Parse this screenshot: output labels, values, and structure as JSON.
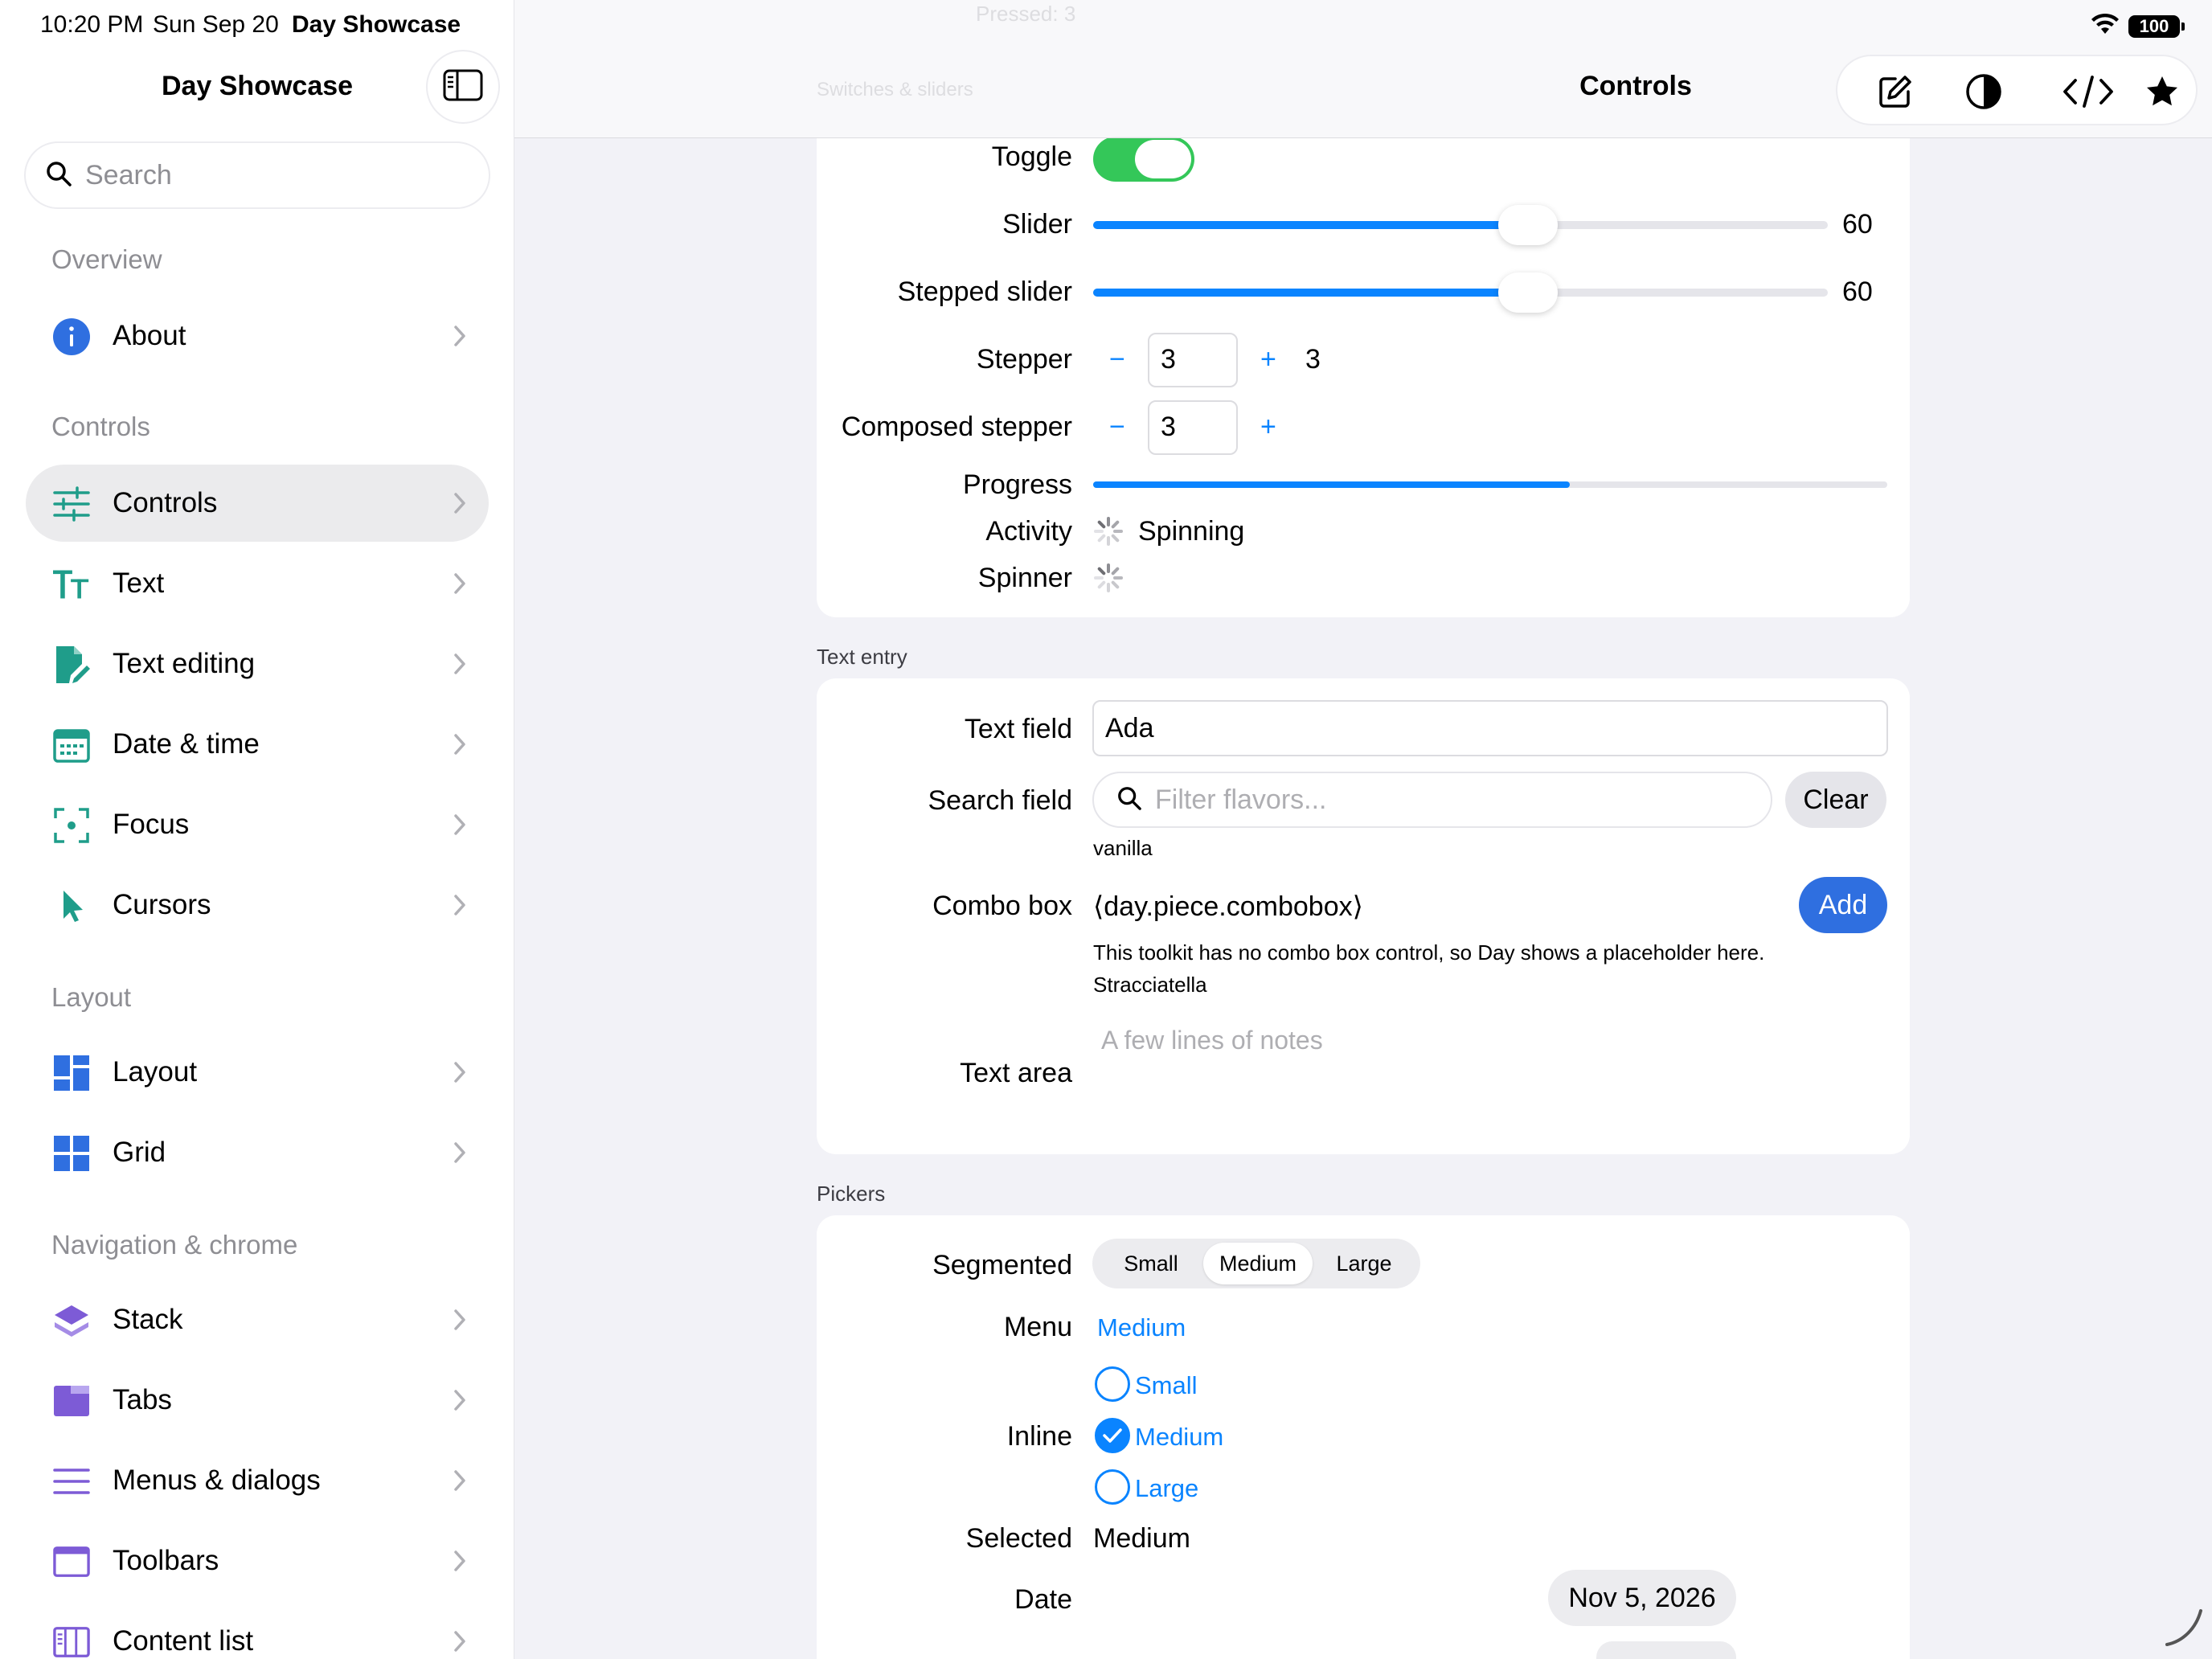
{
  "status_bar": {
    "time": "10:20 PM",
    "date": "Sun Sep 20",
    "app": "Day Showcase",
    "battery": "100"
  },
  "sidebar": {
    "title": "Day Showcase",
    "search_placeholder": "Search",
    "sections": [
      {
        "title": "Overview",
        "items": [
          {
            "label": "About",
            "icon": "info-icon",
            "color": "#2f6fe0"
          }
        ]
      },
      {
        "title": "Controls",
        "items": [
          {
            "label": "Controls",
            "icon": "sliders-icon",
            "color": "#1f9d8a",
            "active": true
          },
          {
            "label": "Text",
            "icon": "text-size-icon",
            "color": "#1f9d8a"
          },
          {
            "label": "Text editing",
            "icon": "doc-edit-icon",
            "color": "#1f9d8a"
          },
          {
            "label": "Date & time",
            "icon": "calendar-icon",
            "color": "#1f9d8a"
          },
          {
            "label": "Focus",
            "icon": "focus-icon",
            "color": "#1f9d8a"
          },
          {
            "label": "Cursors",
            "icon": "cursor-icon",
            "color": "#1f9d8a"
          }
        ]
      },
      {
        "title": "Layout",
        "items": [
          {
            "label": "Layout",
            "icon": "layout-icon",
            "color": "#2f6fe0"
          },
          {
            "label": "Grid",
            "icon": "grid-icon",
            "color": "#2f6fe0"
          }
        ]
      },
      {
        "title": "Navigation & chrome",
        "items": [
          {
            "label": "Stack",
            "icon": "stack-icon",
            "color": "#7d5bd6"
          },
          {
            "label": "Tabs",
            "icon": "tabs-icon",
            "color": "#7d5bd6"
          },
          {
            "label": "Menus & dialogs",
            "icon": "menu-lines-icon",
            "color": "#7d5bd6"
          },
          {
            "label": "Toolbars",
            "icon": "window-icon",
            "color": "#7d5bd6"
          },
          {
            "label": "Content list",
            "icon": "columns-icon",
            "color": "#7d5bd6"
          }
        ]
      }
    ]
  },
  "header": {
    "title": "Controls",
    "ghost_top": "Pressed: 3",
    "ghost_section": "Switches & sliders"
  },
  "controls": {
    "toggle": {
      "label": "Toggle",
      "on": true
    },
    "slider": {
      "label": "Slider",
      "value": "60",
      "fraction": 0.6
    },
    "stepped_slider": {
      "label": "Stepped slider",
      "value": "60",
      "fraction": 0.6
    },
    "stepper": {
      "label": "Stepper",
      "minus": "−",
      "plus": "+",
      "value": "3",
      "readout": "3"
    },
    "composed_stepper": {
      "label": "Composed stepper",
      "minus": "−",
      "plus": "+",
      "value": "3"
    },
    "progress": {
      "label": "Progress",
      "fraction": 0.6
    },
    "activity": {
      "label": "Activity",
      "text": "Spinning"
    },
    "spinner": {
      "label": "Spinner"
    }
  },
  "text_entry": {
    "header": "Text entry",
    "text_field": {
      "label": "Text field",
      "value": "Ada"
    },
    "search_field": {
      "label": "Search field",
      "placeholder": "Filter flavors...",
      "clear": "Clear",
      "echo": "vanilla"
    },
    "combo_box": {
      "label": "Combo box",
      "value": "⟨day.piece.combobox⟩",
      "add": "Add",
      "note": "This toolkit has no combo box control, so Day shows a placeholder here.",
      "selected": "Stracciatella"
    },
    "text_area": {
      "label": "Text area",
      "placeholder": "A few lines of notes"
    }
  },
  "pickers": {
    "header": "Pickers",
    "segmented": {
      "label": "Segmented",
      "options": [
        "Small",
        "Medium",
        "Large"
      ],
      "selected": "Medium"
    },
    "menu": {
      "label": "Menu",
      "value": "Medium"
    },
    "inline": {
      "label": "Inline",
      "options": [
        "Small",
        "Medium",
        "Large"
      ],
      "selected": "Medium"
    },
    "selected": {
      "label": "Selected",
      "value": "Medium"
    },
    "date": {
      "label": "Date",
      "value": "Nov 5, 2026"
    }
  },
  "colors": {
    "accent": "#0a84ff",
    "toggle_on": "#34c759",
    "primary_button": "#2f6fe0"
  }
}
